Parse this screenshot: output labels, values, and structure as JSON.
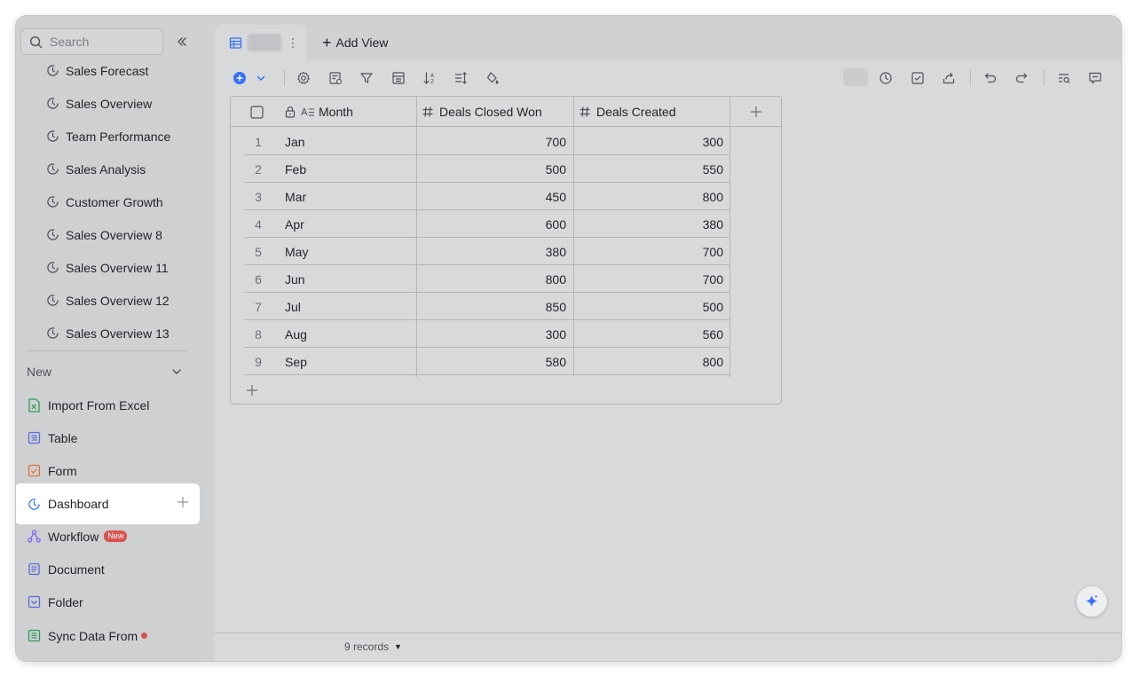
{
  "sidebar": {
    "search_placeholder": "Search",
    "dashboards": [
      {
        "label": "Sales Forecast"
      },
      {
        "label": "Sales Overview"
      },
      {
        "label": "Team Performance"
      },
      {
        "label": "Sales Analysis"
      },
      {
        "label": "Customer Growth"
      },
      {
        "label": "Sales Overview 8"
      },
      {
        "label": "Sales Overview 11"
      },
      {
        "label": "Sales Overview 12"
      },
      {
        "label": "Sales Overview 13"
      }
    ],
    "new_section_label": "New",
    "new_items": [
      {
        "label": "Import From Excel",
        "icon": "excel-icon"
      },
      {
        "label": "Table",
        "icon": "table-icon"
      },
      {
        "label": "Form",
        "icon": "form-icon"
      },
      {
        "label": "Dashboard",
        "icon": "dashboard-icon"
      },
      {
        "label": "Workflow",
        "icon": "workflow-icon",
        "badge": "New"
      },
      {
        "label": "Document",
        "icon": "document-icon"
      },
      {
        "label": "Folder",
        "icon": "folder-icon"
      },
      {
        "label": "Sync Data From",
        "icon": "sync-icon"
      }
    ]
  },
  "tabs": {
    "add_view_label": "Add View"
  },
  "grid": {
    "columns": [
      {
        "label": "Month"
      },
      {
        "label": "Deals Closed Won"
      },
      {
        "label": "Deals Created"
      }
    ],
    "rows": [
      {
        "idx": "1",
        "month": "Jan",
        "won": "700",
        "created": "300"
      },
      {
        "idx": "2",
        "month": "Feb",
        "won": "500",
        "created": "550"
      },
      {
        "idx": "3",
        "month": "Mar",
        "won": "450",
        "created": "800"
      },
      {
        "idx": "4",
        "month": "Apr",
        "won": "600",
        "created": "380"
      },
      {
        "idx": "5",
        "month": "May",
        "won": "380",
        "created": "700"
      },
      {
        "idx": "6",
        "month": "Jun",
        "won": "800",
        "created": "700"
      },
      {
        "idx": "7",
        "month": "Jul",
        "won": "850",
        "created": "500"
      },
      {
        "idx": "8",
        "month": "Aug",
        "won": "300",
        "created": "560"
      },
      {
        "idx": "9",
        "month": "Sep",
        "won": "580",
        "created": "800"
      }
    ]
  },
  "footer": {
    "records_label": "9 records"
  },
  "colors": {
    "accent": "#3370ff",
    "badge": "#d9534f",
    "excel": "#2e9b58",
    "form": "#e0703a",
    "purple": "#7b61ff"
  }
}
